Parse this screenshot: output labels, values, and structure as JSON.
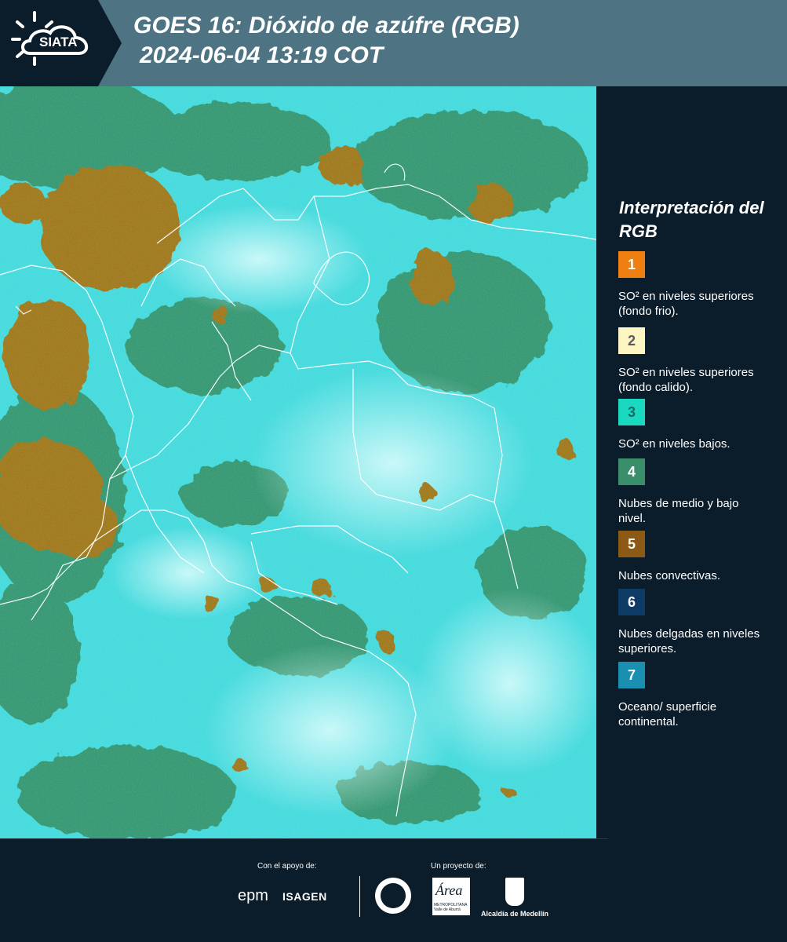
{
  "header": {
    "logo_text": "SIATA",
    "title_line1": "GOES 16: Dióxido de azúfre (RGB)",
    "title_line2": "2024-06-04 13:19 COT"
  },
  "legend": {
    "title": "Interpretación del RGB",
    "items": [
      {
        "number": "1",
        "label": "SO² en niveles superiores (fondo frio).",
        "color": "#f07f12",
        "text_color": "#ffffff"
      },
      {
        "number": "2",
        "label": "SO² en niveles superiores (fondo calido).",
        "color": "#fdf6c3",
        "text_color": "#5a5a5a"
      },
      {
        "number": "3",
        "label": "SO² en niveles bajos.",
        "color": "#1ad9c0",
        "text_color": "#1a6a66"
      },
      {
        "number": "4",
        "label": "Nubes de medio y bajo nivel.",
        "color": "#3a8f6a",
        "text_color": "#ffffff"
      },
      {
        "number": "5",
        "label": "Nubes convectivas.",
        "color": "#8c5a14",
        "text_color": "#ffffff"
      },
      {
        "number": "6",
        "label": "Nubes delgadas en niveles superiores.",
        "color": "#0e3a66",
        "text_color": "#ffffff"
      },
      {
        "number": "7",
        "label": "Oceano/ superficie continental.",
        "color": "#1a8fb0",
        "text_color": "#ffffff"
      }
    ]
  },
  "footer": {
    "support_label": "Con el apoyo de:",
    "project_label": "Un proyecto de:",
    "epm": "epm",
    "isagen": "ISAGEN",
    "area_logo": "Área",
    "area_sub": "METROPOLITANA Valle de Aburrá",
    "alcaldia": "Alcaldía de Medellín"
  },
  "colors": {
    "background": "#0b1c2a",
    "header": "#4e7383",
    "map_cyan": "#3fe3e0",
    "map_green": "#2f8a5c",
    "map_brown": "#9c7419"
  }
}
